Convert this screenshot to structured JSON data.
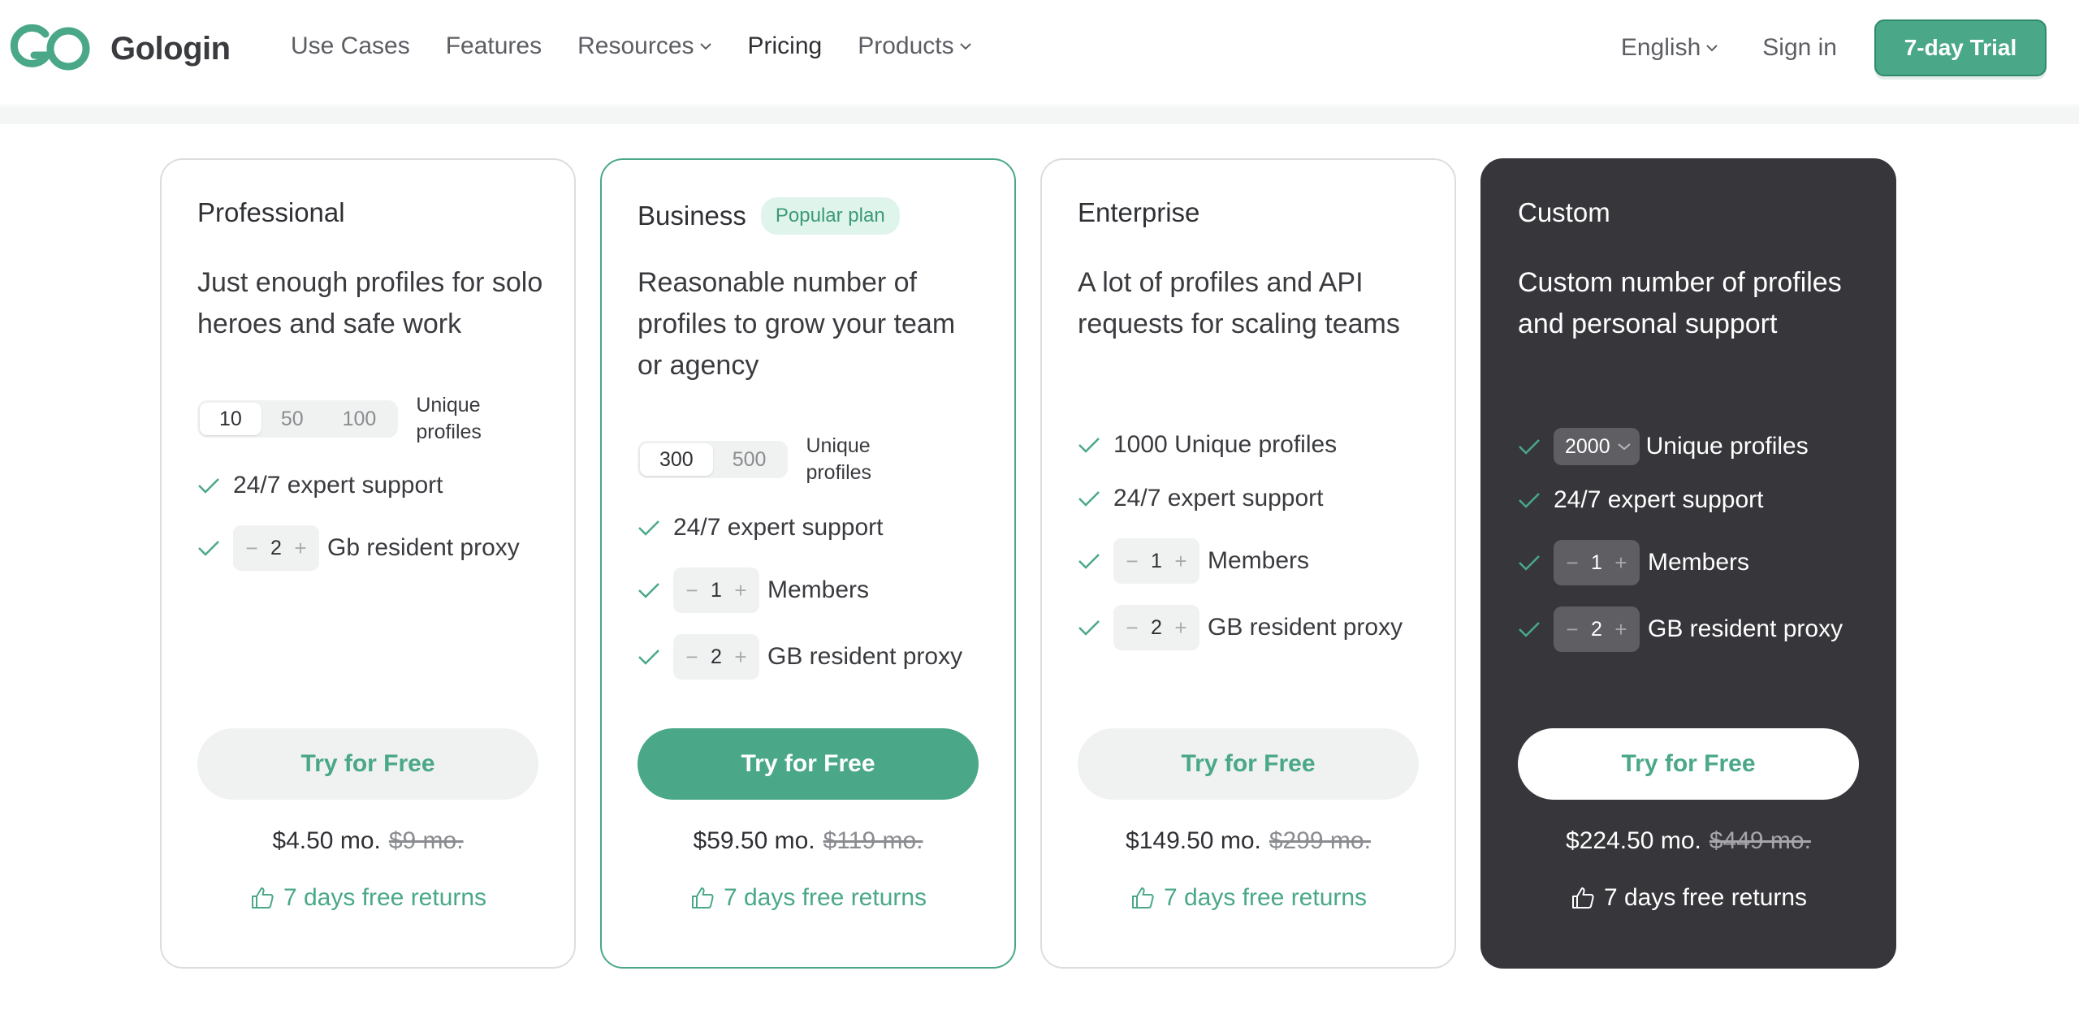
{
  "header": {
    "brand": "Gologin",
    "nav": [
      {
        "label": "Use Cases"
      },
      {
        "label": "Features"
      },
      {
        "label": "Resources"
      },
      {
        "label": "Pricing"
      },
      {
        "label": "Products"
      }
    ],
    "language": "English",
    "signin": "Sign in",
    "trial_button": "7-day Trial"
  },
  "colors": {
    "brand_green": "#4aa889",
    "dark_card": "#36363b"
  },
  "plans": [
    {
      "name": "Professional",
      "tagline": "Just enough profiles for solo heroes and safe work",
      "profile_options": [
        "10",
        "50",
        "100"
      ],
      "profile_selected": "10",
      "profiles_label": "Unique profiles",
      "support": "24/7 expert support",
      "proxy_value": "2",
      "proxy_label": "Gb resident proxy",
      "cta": "Try for Free",
      "price": "$4.50 mo.",
      "old_price": "$9 mo.",
      "returns": "7 days free returns"
    },
    {
      "name": "Business",
      "badge": "Popular plan",
      "tagline": "Reasonable number of profiles to grow your team or agency",
      "profile_options": [
        "300",
        "500"
      ],
      "profile_selected": "300",
      "profiles_label": "Unique profiles",
      "support": "24/7 expert support",
      "members_value": "1",
      "members_label": "Members",
      "proxy_value": "2",
      "proxy_label": "GB resident proxy",
      "cta": "Try for Free",
      "price": "$59.50 mo.",
      "old_price": "$119 mo.",
      "returns": "7 days free returns"
    },
    {
      "name": "Enterprise",
      "tagline": "A lot of profiles and API requests for scaling teams",
      "profiles_text": "1000 Unique profiles",
      "support": "24/7 expert support",
      "members_value": "1",
      "members_label": "Members",
      "proxy_value": "2",
      "proxy_label": "GB resident proxy",
      "cta": "Try for Free",
      "price": "$149.50 mo.",
      "old_price": "$299 mo.",
      "returns": "7 days free returns"
    },
    {
      "name": "Custom",
      "tagline": "Custom number of profiles and personal support",
      "profiles_dropdown": "2000",
      "profiles_label": "Unique profiles",
      "support": "24/7 expert support",
      "members_value": "1",
      "members_label": "Members",
      "proxy_value": "2",
      "proxy_label": "GB resident proxy",
      "cta": "Try for Free",
      "price": "$224.50 mo.",
      "old_price": "$449 mo.",
      "returns": "7 days free returns"
    }
  ]
}
